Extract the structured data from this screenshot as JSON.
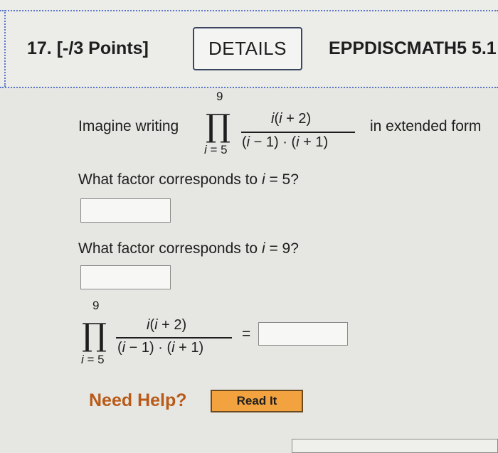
{
  "header": {
    "question_number": "17.",
    "points": "[-/3 Points]",
    "details_label": "DETAILS",
    "course_code": "EPPDISCMATH5 5.1"
  },
  "question": {
    "intro": "Imagine writing",
    "outro": "in extended form",
    "product_upper": "9",
    "product_lower": "i = 5",
    "numerator": "i(i + 2)",
    "denominator": "(i − 1) · (i + 1)",
    "part1_prompt": "What factor corresponds to i = 5?",
    "part2_prompt": "What factor corresponds to i = 9?",
    "equals": "="
  },
  "help": {
    "need_help": "Need Help?",
    "read_it": "Read It"
  }
}
